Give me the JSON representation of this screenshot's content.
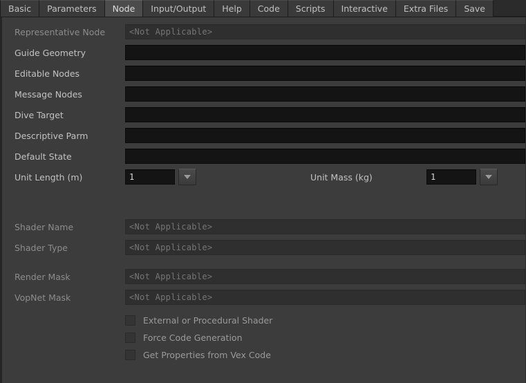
{
  "tabs": [
    {
      "label": "Basic",
      "selected": false
    },
    {
      "label": "Parameters",
      "selected": false
    },
    {
      "label": "Node",
      "selected": true
    },
    {
      "label": "Input/Output",
      "selected": false
    },
    {
      "label": "Help",
      "selected": false
    },
    {
      "label": "Code",
      "selected": false
    },
    {
      "label": "Scripts",
      "selected": false
    },
    {
      "label": "Interactive",
      "selected": false
    },
    {
      "label": "Extra Files",
      "selected": false
    },
    {
      "label": "Save",
      "selected": false
    }
  ],
  "node": {
    "representative_node": {
      "label": "Representative Node",
      "value": "<Not Applicable>",
      "disabled": true
    },
    "guide_geometry": {
      "label": "Guide Geometry",
      "value": "",
      "disabled": false
    },
    "editable_nodes": {
      "label": "Editable Nodes",
      "value": "",
      "disabled": false
    },
    "message_nodes": {
      "label": "Message Nodes",
      "value": "",
      "disabled": false
    },
    "dive_target": {
      "label": "Dive Target",
      "value": "",
      "disabled": false
    },
    "descriptive_parm": {
      "label": "Descriptive Parm",
      "value": "",
      "disabled": false
    },
    "default_state": {
      "label": "Default State",
      "value": "",
      "disabled": false
    },
    "unit_length": {
      "label": "Unit Length (m)",
      "value": "1",
      "dropdown_icon": "chevron-down-icon"
    },
    "unit_mass": {
      "label": "Unit Mass (kg)",
      "value": "1",
      "dropdown_icon": "chevron-down-icon"
    },
    "shader_name": {
      "label": "Shader Name",
      "value": "<Not Applicable>",
      "disabled": true
    },
    "shader_type": {
      "label": "Shader Type",
      "value": "<Not Applicable>",
      "disabled": true
    },
    "render_mask": {
      "label": "Render Mask",
      "value": "<Not Applicable>",
      "disabled": true
    },
    "vopnet_mask": {
      "label": "VopNet Mask",
      "value": "<Not Applicable>",
      "disabled": true
    },
    "checkboxes": [
      {
        "label": "External or Procedural Shader",
        "checked": false
      },
      {
        "label": "Force Code Generation",
        "checked": false
      },
      {
        "label": "Get Properties from Vex Code",
        "checked": false
      }
    ]
  },
  "colors": {
    "window_bg": "#3c3c3c",
    "tabbar_bg": "#2b2b2b",
    "tab_bg": "#3a3a3a",
    "tab_selected_bg": "#4c4c4c",
    "field_bg": "#141414",
    "field_disabled_bg": "#2f2f2f",
    "label_text": "#c2c2c2",
    "label_disabled_text": "#8c8c8c",
    "field_disabled_text": "#757575"
  }
}
